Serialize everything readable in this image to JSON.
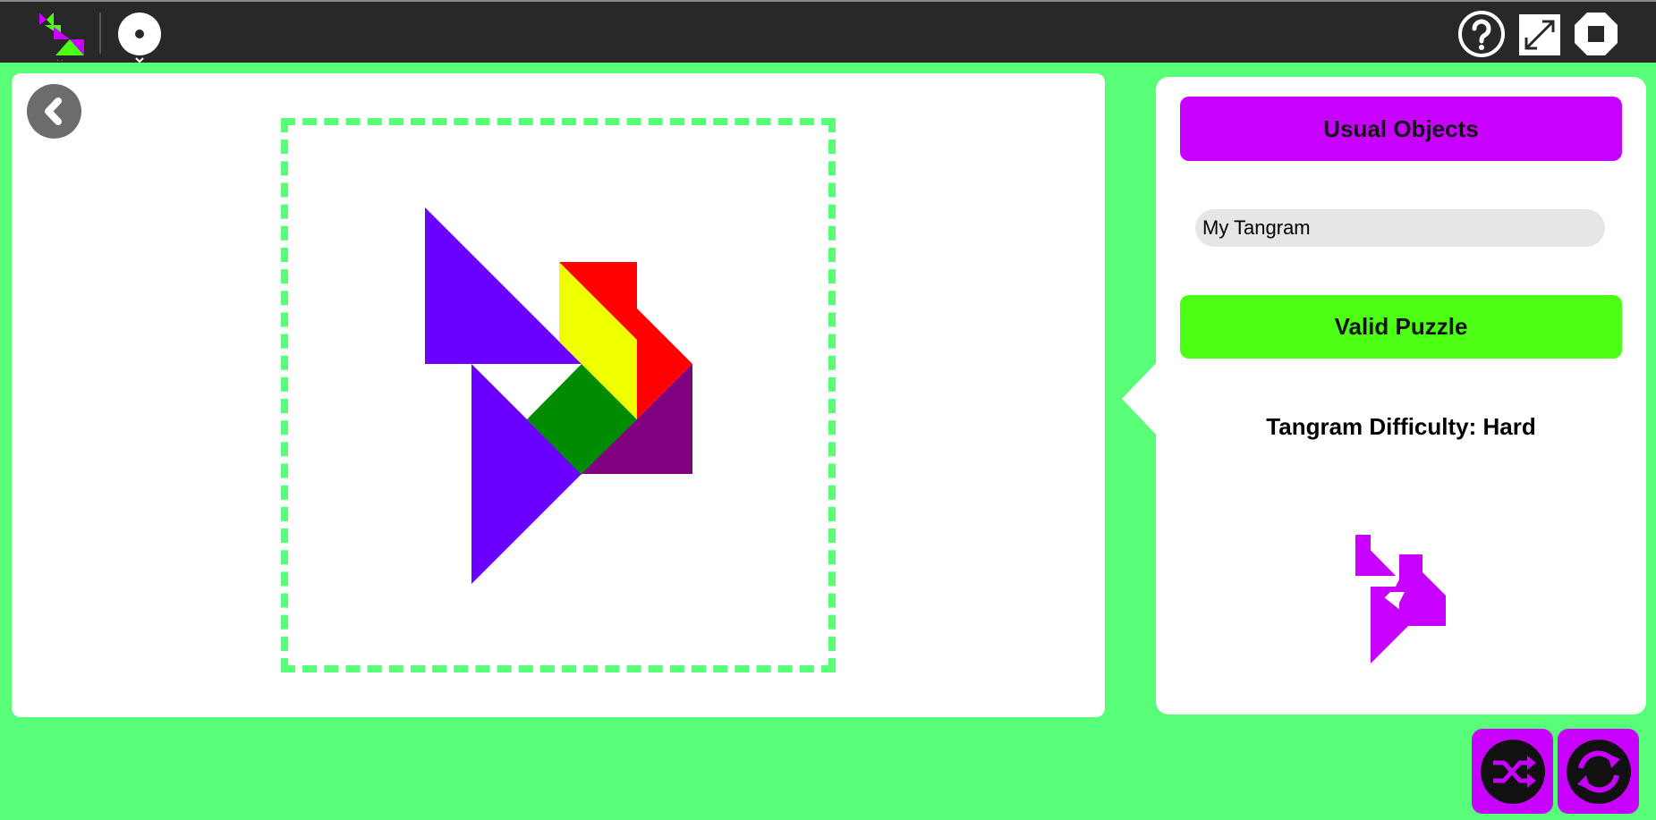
{
  "app": {
    "accent_color": "#c800ff",
    "background_color": "#58fd78",
    "toolbar_color": "#282828"
  },
  "toolbar": {
    "left_items": [
      {
        "name": "activity-icon",
        "has_dropdown": true
      },
      {
        "name": "player-icon",
        "has_dropdown": true
      }
    ],
    "right_items": [
      {
        "name": "help-icon"
      },
      {
        "name": "fullscreen-icon"
      },
      {
        "name": "stop-icon"
      }
    ]
  },
  "sidebar": {
    "category_label": "Usual Objects",
    "tangram_name": "My Tangram",
    "validity_label": "Valid Puzzle",
    "difficulty_label": "Tangram Difficulty: Hard"
  },
  "board": {
    "pieces": [
      {
        "shape": "large-triangle",
        "color": "#6a00ff"
      },
      {
        "shape": "large-triangle",
        "color": "#6a00ff"
      },
      {
        "shape": "square",
        "color": "#008c00"
      },
      {
        "shape": "parallelogram",
        "color": "#f0ff00"
      },
      {
        "shape": "small-triangle",
        "color": "#ff0000"
      },
      {
        "shape": "medium-triangle",
        "color": "#800080"
      }
    ]
  },
  "actions": [
    {
      "name": "shuffle-icon"
    },
    {
      "name": "refresh-icon"
    }
  ]
}
